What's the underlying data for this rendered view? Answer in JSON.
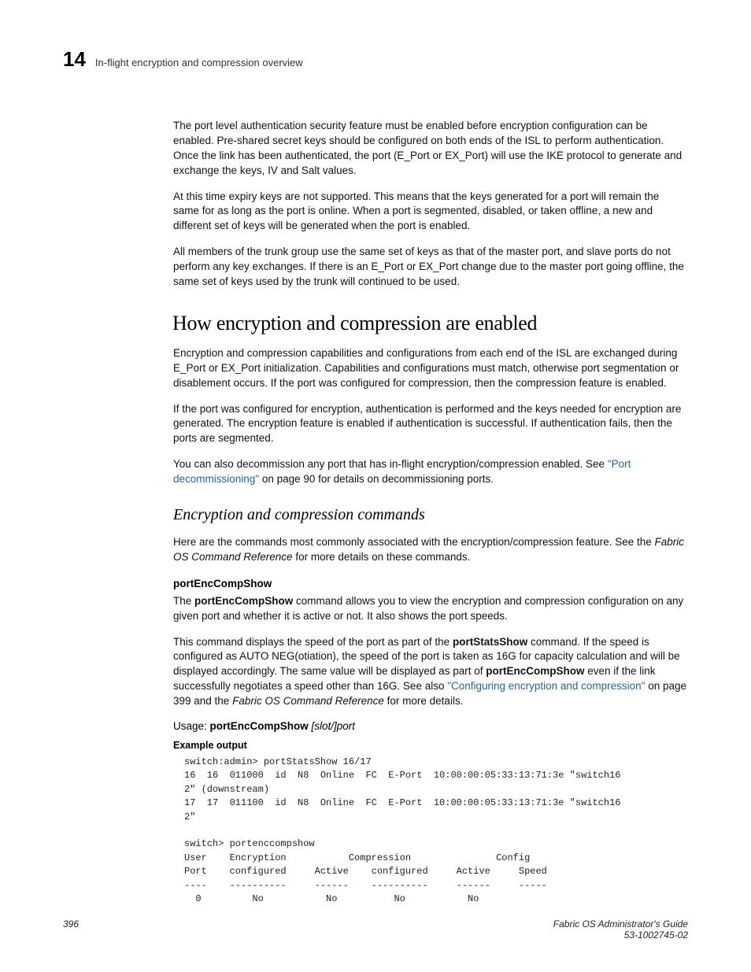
{
  "header": {
    "chapter": "14",
    "title": "In-flight encryption and compression overview"
  },
  "paras": {
    "p1": "The port level authentication security feature must be enabled before encryption configuration can be enabled. Pre-shared secret keys should be configured on both ends of the ISL to perform authentication. Once the link has been authenticated, the port (E_Port or EX_Port) will use the IKE protocol to generate and exchange the keys, IV and Salt values.",
    "p2": "At this time expiry keys are not supported. This means that the keys generated for a port will remain the same for as long as the port is online. When a port is segmented, disabled, or taken offline, a new and different set of keys will be generated when the port is enabled.",
    "p3": "All members of the trunk group use the same set of keys as that of the master port, and slave ports do not perform any key exchanges. If there is an E_Port or EX_Port change due to the master port going offline, the same set of keys used by the trunk will continued to be used."
  },
  "h2": "How encryption and compression are enabled",
  "sec2": {
    "p1": "Encryption and compression capabilities and configurations from each end of the ISL are exchanged during E_Port or EX_Port initialization. Capabilities and configurations must match, otherwise port segmentation or disablement occurs. If the port was configured for compression, then the compression feature is enabled.",
    "p2": "If the port was configured for encryption, authentication is performed and the keys needed for encryption are generated. The encryption feature is enabled if authentication is successful. If authentication fails, then the ports are segmented.",
    "p3a": "You can also decommission any port that has in-flight encryption/compression enabled. See ",
    "p3link": "\"Port decommissioning\"",
    "p3b": " on page 90 for details on decommissioning ports."
  },
  "h3": "Encryption and compression commands",
  "sec3": {
    "p1a": "Here are the commands most commonly associated with the encryption/compression feature. See the ",
    "p1ref": "Fabric OS Command Reference",
    "p1b": " for more details on these commands."
  },
  "h4a": "portEncCompShow",
  "sec4": {
    "p1a": "The ",
    "p1cmd": "portEncCompShow",
    "p1b": " command allows you to view the encryption and compression configuration on any given port and whether it is active or not. It also shows the port speeds.",
    "p2a": "This command displays the speed of the port as part of the ",
    "p2cmd1": "portStatsShow",
    "p2b": " command. If the speed is configured as AUTO NEG(otiation), the speed of the port is taken as 16G for capacity calculation and will be displayed accordingly. The same value will be displayed as part of ",
    "p2cmd2": "portEncCompShow",
    "p2c": " even if the link successfully negotiates a speed other than 16G. See also ",
    "p2link": "\"Configuring encryption and compression\"",
    "p2d": " on page 399 and the ",
    "p2ref": "Fabric OS Command Reference",
    "p2e": " for more details.",
    "usage_label": "Usage: ",
    "usage_cmd": "portEncCompShow",
    "usage_arg": " [slot/]port"
  },
  "h5": "Example output",
  "code": "switch:admin> portStatsShow 16/17\n16  16  011000  id  N8  Online  FC  E-Port  10:00:00:05:33:13:71:3e \"switch16\n2\" (downstream)\n17  17  011100  id  N8  Online  FC  E-Port  10:00:00:05:33:13:71:3e \"switch16\n2\"\n\nswitch> portenccompshow\nUser    Encryption           Compression               Config\nPort    configured     Active    configured     Active     Speed\n----    ----------     ------    ----------     ------     -----\n  0         No           No          No           No",
  "footer": {
    "page": "396",
    "guide": "Fabric OS Administrator's Guide",
    "docnum": "53-1002745-02"
  }
}
